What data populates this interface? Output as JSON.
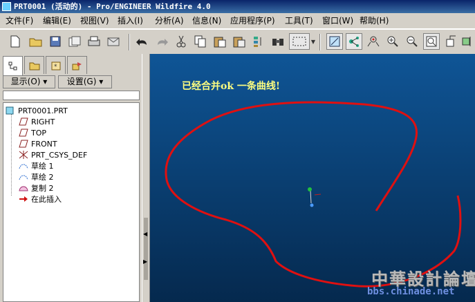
{
  "window": {
    "title": "PRT0001 (活动的) - Pro/ENGINEER Wildfire 4.0"
  },
  "menu": [
    {
      "label": "文件(F)"
    },
    {
      "label": "编辑(E)"
    },
    {
      "label": "视图(V)"
    },
    {
      "label": "插入(I)"
    },
    {
      "label": "分析(A)"
    },
    {
      "label": "信息(N)"
    },
    {
      "label": "应用程序(P)"
    },
    {
      "label": "工具(T)"
    },
    {
      "label": "窗口(W)"
    },
    {
      "label": "帮助(H)"
    }
  ],
  "toolbar_icons": [
    "new-file-icon",
    "open-folder-icon",
    "save-icon",
    "save-copy-icon",
    "print-icon",
    "send-mail-icon",
    "undo-icon",
    "redo-icon",
    "cut-icon",
    "copy-icon",
    "paste-icon",
    "paste-special-icon",
    "regenerate-icon",
    "find-icon",
    "select-box-icon",
    "repaint-icon",
    "spin-center-icon",
    "csys-display-icon",
    "zoom-in-icon",
    "zoom-out-icon",
    "refit-icon",
    "reorient-icon",
    "view-list-icon"
  ],
  "panel": {
    "show_label": "显示(O) ▾",
    "settings_label": "设置(G) ▾"
  },
  "tree": {
    "root": "PRT0001.PRT",
    "items": [
      {
        "label": "RIGHT",
        "icon": "datum-plane-icon"
      },
      {
        "label": "TOP",
        "icon": "datum-plane-icon"
      },
      {
        "label": "FRONT",
        "icon": "datum-plane-icon"
      },
      {
        "label": "PRT_CSYS_DEF",
        "icon": "coordinate-system-icon"
      },
      {
        "label": "草绘 1",
        "icon": "sketch-icon"
      },
      {
        "label": "草绘 2",
        "icon": "sketch-icon"
      },
      {
        "label": "复制 2",
        "icon": "copy-feature-icon"
      },
      {
        "label": "在此插入",
        "icon": "insert-here-arrow-icon"
      }
    ]
  },
  "viewport": {
    "annotation": "已经合并ok   一条曲线!",
    "background": "#0b4a86",
    "curve_color": "#e01010"
  },
  "watermark": {
    "big": "中華設計論壇",
    "url": "bbs.chinade.net"
  }
}
